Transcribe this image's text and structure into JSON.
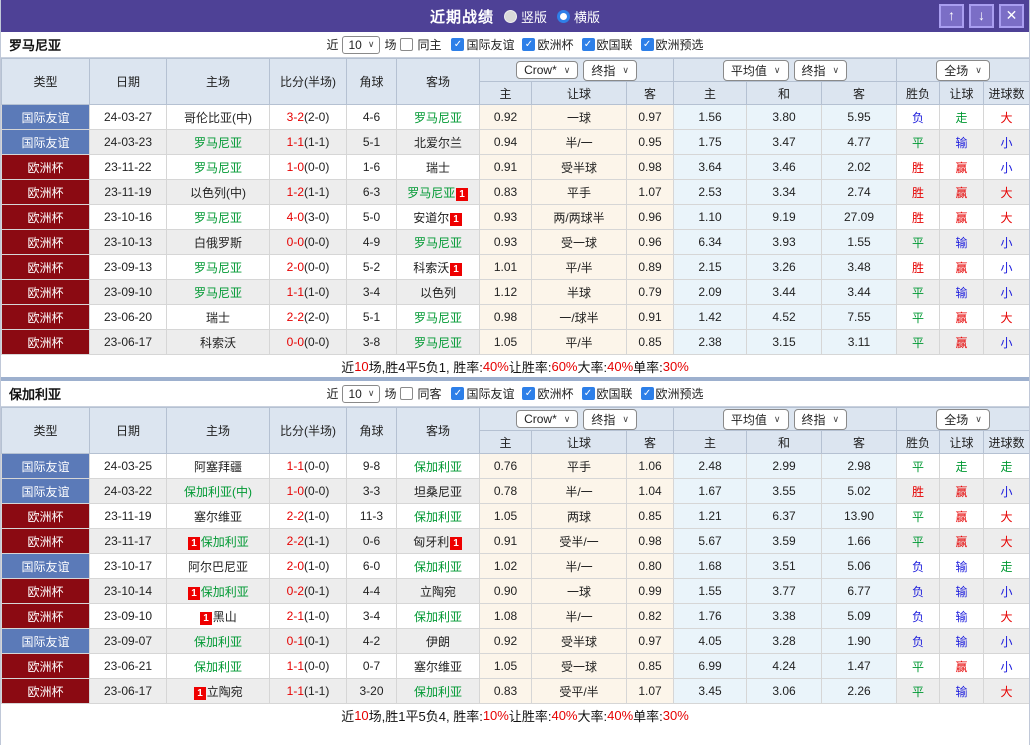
{
  "titlebar": {
    "title": "近期战绩",
    "radio_vertical": "竖版",
    "radio_horizontal": "横版",
    "selected_mode": "横版"
  },
  "icons": {
    "up": "↑",
    "down": "↓",
    "close": "✕",
    "check": "✓",
    "chevron": "∨"
  },
  "filters": {
    "near_label": "近",
    "near_value": "10",
    "games_label": "场",
    "leagues": [
      "国际友谊",
      "欧洲杯",
      "欧国联",
      "欧洲预选"
    ]
  },
  "table_header": {
    "cols": [
      "类型",
      "日期",
      "主场",
      "比分(半场)",
      "角球",
      "客场"
    ],
    "crow_select": "Crow*",
    "final_select": "终指",
    "avg_select": "平均值",
    "final_select2": "终指",
    "scope_select": "全场",
    "crow_cols": [
      "主",
      "让球",
      "客"
    ],
    "avg_cols": [
      "主",
      "和",
      "客"
    ],
    "result_cols": [
      "胜负",
      "让球",
      "进球数"
    ]
  },
  "colors": {
    "type_bg": {
      "国际友谊": "#5b7ab8",
      "欧洲杯": "#8b0a12"
    },
    "result": {
      "胜": "#e60000",
      "赢": "#e60000",
      "大": "#e60000",
      "平": "#009933",
      "走": "#009933",
      "负": "#2020dd",
      "输": "#2020dd",
      "小": "#2020dd"
    },
    "accent_purple": "#4e4196",
    "focus_green": "#009933",
    "score_red": "#e60000"
  },
  "sections": [
    {
      "team": "罗马尼亚",
      "same_label": "同主",
      "same_checked": false,
      "rows": [
        {
          "type": "国际友谊",
          "date": "24-03-27",
          "home": "哥伦比亚(中)",
          "home_focus": false,
          "home_badge": "",
          "score": "3-2",
          "half": "(2-0)",
          "corner": "4-6",
          "away": "罗马尼亚",
          "away_focus": true,
          "away_badge": "",
          "crow": [
            "0.92",
            "一球",
            "0.97"
          ],
          "avg": [
            "1.56",
            "3.80",
            "5.95"
          ],
          "result": [
            "负",
            "走",
            "大"
          ]
        },
        {
          "type": "国际友谊",
          "date": "24-03-23",
          "home": "罗马尼亚",
          "home_focus": true,
          "home_badge": "",
          "score": "1-1",
          "half": "(1-1)",
          "corner": "5-1",
          "away": "北爱尔兰",
          "away_focus": false,
          "away_badge": "",
          "crow": [
            "0.94",
            "半/一",
            "0.95"
          ],
          "avg": [
            "1.75",
            "3.47",
            "4.77"
          ],
          "result": [
            "平",
            "输",
            "小"
          ]
        },
        {
          "type": "欧洲杯",
          "date": "23-11-22",
          "home": "罗马尼亚",
          "home_focus": true,
          "home_badge": "",
          "score": "1-0",
          "half": "(0-0)",
          "corner": "1-6",
          "away": "瑞士",
          "away_focus": false,
          "away_badge": "",
          "crow": [
            "0.91",
            "受半球",
            "0.98"
          ],
          "avg": [
            "3.64",
            "3.46",
            "2.02"
          ],
          "result": [
            "胜",
            "赢",
            "小"
          ]
        },
        {
          "type": "欧洲杯",
          "date": "23-11-19",
          "home": "以色列(中)",
          "home_focus": false,
          "home_badge": "",
          "score": "1-2",
          "half": "(1-1)",
          "corner": "6-3",
          "away": "罗马尼亚",
          "away_focus": true,
          "away_badge": "1",
          "crow": [
            "0.83",
            "平手",
            "1.07"
          ],
          "avg": [
            "2.53",
            "3.34",
            "2.74"
          ],
          "result": [
            "胜",
            "赢",
            "大"
          ]
        },
        {
          "type": "欧洲杯",
          "date": "23-10-16",
          "home": "罗马尼亚",
          "home_focus": true,
          "home_badge": "",
          "score": "4-0",
          "half": "(3-0)",
          "corner": "5-0",
          "away": "安道尔",
          "away_focus": false,
          "away_badge": "1",
          "crow": [
            "0.93",
            "两/两球半",
            "0.96"
          ],
          "avg": [
            "1.10",
            "9.19",
            "27.09"
          ],
          "result": [
            "胜",
            "赢",
            "大"
          ]
        },
        {
          "type": "欧洲杯",
          "date": "23-10-13",
          "home": "白俄罗斯",
          "home_focus": false,
          "home_badge": "",
          "score": "0-0",
          "half": "(0-0)",
          "corner": "4-9",
          "away": "罗马尼亚",
          "away_focus": true,
          "away_badge": "",
          "crow": [
            "0.93",
            "受一球",
            "0.96"
          ],
          "avg": [
            "6.34",
            "3.93",
            "1.55"
          ],
          "result": [
            "平",
            "输",
            "小"
          ]
        },
        {
          "type": "欧洲杯",
          "date": "23-09-13",
          "home": "罗马尼亚",
          "home_focus": true,
          "home_badge": "",
          "score": "2-0",
          "half": "(0-0)",
          "corner": "5-2",
          "away": "科索沃",
          "away_focus": false,
          "away_badge": "1",
          "crow": [
            "1.01",
            "平/半",
            "0.89"
          ],
          "avg": [
            "2.15",
            "3.26",
            "3.48"
          ],
          "result": [
            "胜",
            "赢",
            "小"
          ]
        },
        {
          "type": "欧洲杯",
          "date": "23-09-10",
          "home": "罗马尼亚",
          "home_focus": true,
          "home_badge": "",
          "score": "1-1",
          "half": "(1-0)",
          "corner": "3-4",
          "away": "以色列",
          "away_focus": false,
          "away_badge": "",
          "crow": [
            "1.12",
            "半球",
            "0.79"
          ],
          "avg": [
            "2.09",
            "3.44",
            "3.44"
          ],
          "result": [
            "平",
            "输",
            "小"
          ]
        },
        {
          "type": "欧洲杯",
          "date": "23-06-20",
          "home": "瑞士",
          "home_focus": false,
          "home_badge": "",
          "score": "2-2",
          "half": "(2-0)",
          "corner": "5-1",
          "away": "罗马尼亚",
          "away_focus": true,
          "away_badge": "",
          "crow": [
            "0.98",
            "一/球半",
            "0.91"
          ],
          "avg": [
            "1.42",
            "4.52",
            "7.55"
          ],
          "result": [
            "平",
            "赢",
            "大"
          ]
        },
        {
          "type": "欧洲杯",
          "date": "23-06-17",
          "home": "科索沃",
          "home_focus": false,
          "home_badge": "",
          "score": "0-0",
          "half": "(0-0)",
          "corner": "3-8",
          "away": "罗马尼亚",
          "away_focus": true,
          "away_badge": "",
          "crow": [
            "1.05",
            "平/半",
            "0.85"
          ],
          "avg": [
            "2.38",
            "3.15",
            "3.11"
          ],
          "result": [
            "平",
            "赢",
            "小"
          ]
        }
      ],
      "summary": [
        {
          "t": "近"
        },
        {
          "t": "10",
          "red": true
        },
        {
          "t": "场,胜4平5负1, 胜率:"
        },
        {
          "t": "40%",
          "red": true
        },
        {
          "t": " 让胜率:"
        },
        {
          "t": "60%",
          "red": true
        },
        {
          "t": " 大率:"
        },
        {
          "t": "40%",
          "red": true
        },
        {
          "t": " 单率:"
        },
        {
          "t": "30%",
          "red": true
        }
      ]
    },
    {
      "team": "保加利亚",
      "same_label": "同客",
      "same_checked": false,
      "rows": [
        {
          "type": "国际友谊",
          "date": "24-03-25",
          "home": "阿塞拜疆",
          "home_focus": false,
          "home_badge": "",
          "score": "1-1",
          "half": "(0-0)",
          "corner": "9-8",
          "away": "保加利亚",
          "away_focus": true,
          "away_badge": "",
          "crow": [
            "0.76",
            "平手",
            "1.06"
          ],
          "avg": [
            "2.48",
            "2.99",
            "2.98"
          ],
          "result": [
            "平",
            "走",
            "走"
          ]
        },
        {
          "type": "国际友谊",
          "date": "24-03-22",
          "home": "保加利亚(中)",
          "home_focus": true,
          "home_badge": "",
          "score": "1-0",
          "half": "(0-0)",
          "corner": "3-3",
          "away": "坦桑尼亚",
          "away_focus": false,
          "away_badge": "",
          "crow": [
            "0.78",
            "半/一",
            "1.04"
          ],
          "avg": [
            "1.67",
            "3.55",
            "5.02"
          ],
          "result": [
            "胜",
            "赢",
            "小"
          ]
        },
        {
          "type": "欧洲杯",
          "date": "23-11-19",
          "home": "塞尔维亚",
          "home_focus": false,
          "home_badge": "",
          "score": "2-2",
          "half": "(1-0)",
          "corner": "11-3",
          "away": "保加利亚",
          "away_focus": true,
          "away_badge": "",
          "crow": [
            "1.05",
            "两球",
            "0.85"
          ],
          "avg": [
            "1.21",
            "6.37",
            "13.90"
          ],
          "result": [
            "平",
            "赢",
            "大"
          ]
        },
        {
          "type": "欧洲杯",
          "date": "23-11-17",
          "home": "保加利亚",
          "home_focus": true,
          "home_badge": "1",
          "score": "2-2",
          "half": "(1-1)",
          "corner": "0-6",
          "away": "匈牙利",
          "away_focus": false,
          "away_badge": "1",
          "crow": [
            "0.91",
            "受半/一",
            "0.98"
          ],
          "avg": [
            "5.67",
            "3.59",
            "1.66"
          ],
          "result": [
            "平",
            "赢",
            "大"
          ]
        },
        {
          "type": "国际友谊",
          "date": "23-10-17",
          "home": "阿尔巴尼亚",
          "home_focus": false,
          "home_badge": "",
          "score": "2-0",
          "half": "(1-0)",
          "corner": "6-0",
          "away": "保加利亚",
          "away_focus": true,
          "away_badge": "",
          "crow": [
            "1.02",
            "半/一",
            "0.80"
          ],
          "avg": [
            "1.68",
            "3.51",
            "5.06"
          ],
          "result": [
            "负",
            "输",
            "走"
          ]
        },
        {
          "type": "欧洲杯",
          "date": "23-10-14",
          "home": "保加利亚",
          "home_focus": true,
          "home_badge": "1",
          "score": "0-2",
          "half": "(0-1)",
          "corner": "4-4",
          "away": "立陶宛",
          "away_focus": false,
          "away_badge": "",
          "crow": [
            "0.90",
            "一球",
            "0.99"
          ],
          "avg": [
            "1.55",
            "3.77",
            "6.77"
          ],
          "result": [
            "负",
            "输",
            "小"
          ]
        },
        {
          "type": "欧洲杯",
          "date": "23-09-10",
          "home": "黑山",
          "home_focus": false,
          "home_badge": "1",
          "score": "2-1",
          "half": "(1-0)",
          "corner": "3-4",
          "away": "保加利亚",
          "away_focus": true,
          "away_badge": "",
          "crow": [
            "1.08",
            "半/一",
            "0.82"
          ],
          "avg": [
            "1.76",
            "3.38",
            "5.09"
          ],
          "result": [
            "负",
            "输",
            "大"
          ]
        },
        {
          "type": "国际友谊",
          "date": "23-09-07",
          "home": "保加利亚",
          "home_focus": true,
          "home_badge": "",
          "score": "0-1",
          "half": "(0-1)",
          "corner": "4-2",
          "away": "伊朗",
          "away_focus": false,
          "away_badge": "",
          "crow": [
            "0.92",
            "受半球",
            "0.97"
          ],
          "avg": [
            "4.05",
            "3.28",
            "1.90"
          ],
          "result": [
            "负",
            "输",
            "小"
          ]
        },
        {
          "type": "欧洲杯",
          "date": "23-06-21",
          "home": "保加利亚",
          "home_focus": true,
          "home_badge": "",
          "score": "1-1",
          "half": "(0-0)",
          "corner": "0-7",
          "away": "塞尔维亚",
          "away_focus": false,
          "away_badge": "",
          "crow": [
            "1.05",
            "受一球",
            "0.85"
          ],
          "avg": [
            "6.99",
            "4.24",
            "1.47"
          ],
          "result": [
            "平",
            "赢",
            "小"
          ]
        },
        {
          "type": "欧洲杯",
          "date": "23-06-17",
          "home": "立陶宛",
          "home_focus": false,
          "home_badge": "1",
          "score": "1-1",
          "half": "(1-1)",
          "corner": "3-20",
          "away": "保加利亚",
          "away_focus": true,
          "away_badge": "",
          "crow": [
            "0.83",
            "受平/半",
            "1.07"
          ],
          "avg": [
            "3.45",
            "3.06",
            "2.26"
          ],
          "result": [
            "平",
            "输",
            "大"
          ]
        }
      ],
      "summary": [
        {
          "t": "近"
        },
        {
          "t": "10",
          "red": true
        },
        {
          "t": "场,胜1平5负4, 胜率:"
        },
        {
          "t": "10%",
          "red": true
        },
        {
          "t": " 让胜率:"
        },
        {
          "t": "40%",
          "red": true
        },
        {
          "t": " 大率:"
        },
        {
          "t": "40%",
          "red": true
        },
        {
          "t": " 单率:"
        },
        {
          "t": "30%",
          "red": true
        }
      ]
    }
  ]
}
